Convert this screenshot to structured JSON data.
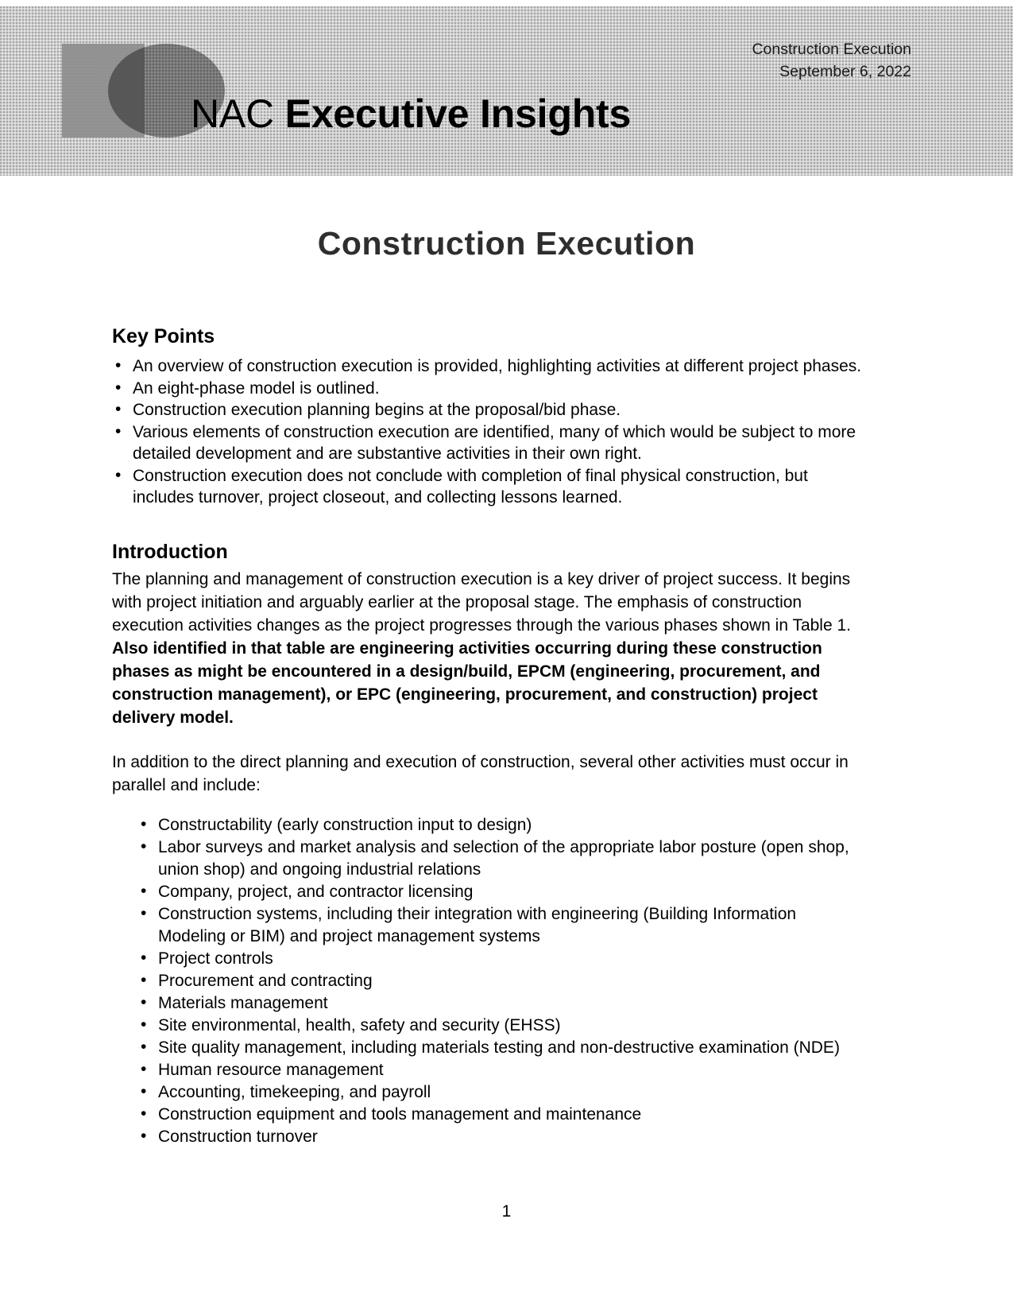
{
  "header": {
    "logo_name": "nac-logo",
    "brand_thin": "NAC ",
    "brand_bold": "Executive Insights",
    "meta_line1": "Construction Execution",
    "meta_line2": "September 6, 2022",
    "band_color": "#cfcfcf",
    "logo_color": "#8d8d8d"
  },
  "document": {
    "title": "Construction Execution",
    "page_number": "1"
  },
  "key_points": {
    "heading": "Key Points",
    "items": [
      "An overview of construction execution is provided, highlighting activities at different project phases.",
      "An eight-phase model is outlined.",
      "Construction execution planning begins at the proposal/bid phase.",
      "Various elements of construction execution are identified, many of which would be subject to more detailed development and are substantive activities in their own right.",
      "Construction execution does not conclude with completion of final physical construction, but includes turnover, project closeout, and collecting lessons learned."
    ]
  },
  "introduction": {
    "heading": "Introduction",
    "paragraph1_normal": "The planning and management of construction execution is a key driver of project success. It begins with project initiation and arguably earlier at the proposal stage. The emphasis of construction execution activities changes as the project progresses through the various phases shown in Table 1.",
    "paragraph1_bold": " Also identified in that table are engineering activities occurring during these construction phases as might be encountered in a design/build, EPCM (engineering, procurement, and construction management), or EPC (engineering, procurement, and construction) project delivery model.",
    "paragraph2": "In addition to the direct planning and execution of construction, several other activities must occur in parallel and include:",
    "activities": [
      "Constructability (early construction input to design)",
      "Labor surveys and market analysis and selection of the appropriate labor posture (open shop, union shop) and ongoing industrial relations",
      "Company, project, and contractor licensing",
      "Construction systems, including their integration with engineering (Building Information Modeling or BIM) and project management systems",
      "Project controls",
      "Procurement and contracting",
      "Materials management",
      "Site environmental, health, safety and security (EHSS)",
      "Site quality management, including materials testing and non-destructive examination (NDE)",
      "Human resource management",
      "Accounting, timekeeping, and payroll",
      "Construction equipment and tools management and maintenance",
      "Construction turnover"
    ]
  }
}
